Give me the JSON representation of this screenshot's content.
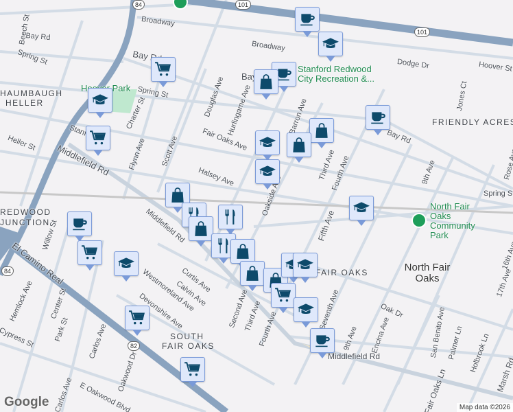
{
  "labels": [
    "Broadway",
    "Broadway",
    "Bay Rd",
    "Bay Rd",
    "Bay Rd",
    "Bay Rd",
    "Spring St",
    "Spring St",
    "Spring St",
    "Beech St",
    "Heller St",
    "Middlefield Rd",
    "Middlefield Rd",
    "Middlefield Rd",
    "Charter St",
    "Flynn Ave",
    "Scott Ave",
    "Douglas Ave",
    "Hurlingame Ave",
    "Fair Oaks Ave",
    "Halsey Ave",
    "Barron Ave",
    "Third Ave",
    "Fourth Ave",
    "Fifth Ave",
    "Dodge Dr",
    "Hoover St",
    "Jones Ct",
    "9th Ave",
    "Rose Ave",
    "Willow St",
    "El Camino Real",
    "Hemlock Ave",
    "Center St",
    "Park St",
    "Cypress St",
    "Carlos Ave",
    "Carlos Ave",
    "Oakwood Dr",
    "E Oakwood Blvd",
    "Curtis Ave",
    "Calvin Ave",
    "Westmoreland Ave",
    "Devonshire Ave",
    "Second Ave",
    "Third Ave",
    "Fourth Ave",
    "Seventh Ave",
    "9th Ave",
    "Encina Ave",
    "Oak Dr",
    "San Benito Ave",
    "Palmer Ln",
    "Holbrook Ln",
    "Fair Oaks Ln",
    "17th Ave",
    "16th Ave",
    "Marsh Rd",
    "Oakside Ave",
    "Stanford Ave"
  ],
  "areas": [
    "HAUMBAUGH",
    "HELLER",
    "FRIENDLY ACRES",
    "REDWOOD",
    "JUNCTION",
    "SOUTH",
    "FAIR OAKS",
    "FAIR OAKS"
  ],
  "places": {
    "north_fair_oaks": "North Fair Oaks",
    "hoover_park": "Hoover Park",
    "stanford_rec": "Stanford Redwood City Recreation &...",
    "nfo_park": "North Fair Oaks Community Park"
  },
  "shields": [
    "84",
    "101",
    "101",
    "84",
    "82"
  ],
  "markers": [
    {
      "type": "coffee"
    },
    {
      "type": "school"
    },
    {
      "type": "coffee"
    },
    {
      "type": "shopping"
    },
    {
      "type": "grocery"
    },
    {
      "type": "school"
    },
    {
      "type": "grocery"
    },
    {
      "type": "coffee"
    },
    {
      "type": "shopping"
    },
    {
      "type": "shopping"
    },
    {
      "type": "school"
    },
    {
      "type": "school"
    },
    {
      "type": "school"
    },
    {
      "type": "shopping"
    },
    {
      "type": "restaurant"
    },
    {
      "type": "restaurant"
    },
    {
      "type": "shopping"
    },
    {
      "type": "coffee"
    },
    {
      "type": "grocery"
    },
    {
      "type": "school"
    },
    {
      "type": "restaurant"
    },
    {
      "type": "shopping"
    },
    {
      "type": "shopping"
    },
    {
      "type": "shopping"
    },
    {
      "type": "grocery"
    },
    {
      "type": "school"
    },
    {
      "type": "school"
    },
    {
      "type": "school"
    },
    {
      "type": "coffee"
    },
    {
      "type": "grocery"
    },
    {
      "type": "grocery"
    }
  ],
  "footer": {
    "logo": "Google",
    "attribution": "Map data ©2026"
  },
  "colors": {
    "highway": "#8aa3bf",
    "marker_bg": "#dfe8fb",
    "marker_icon": "#0d4a6b",
    "park": "#bfe8cf",
    "park_text": "#1e8a4f"
  }
}
